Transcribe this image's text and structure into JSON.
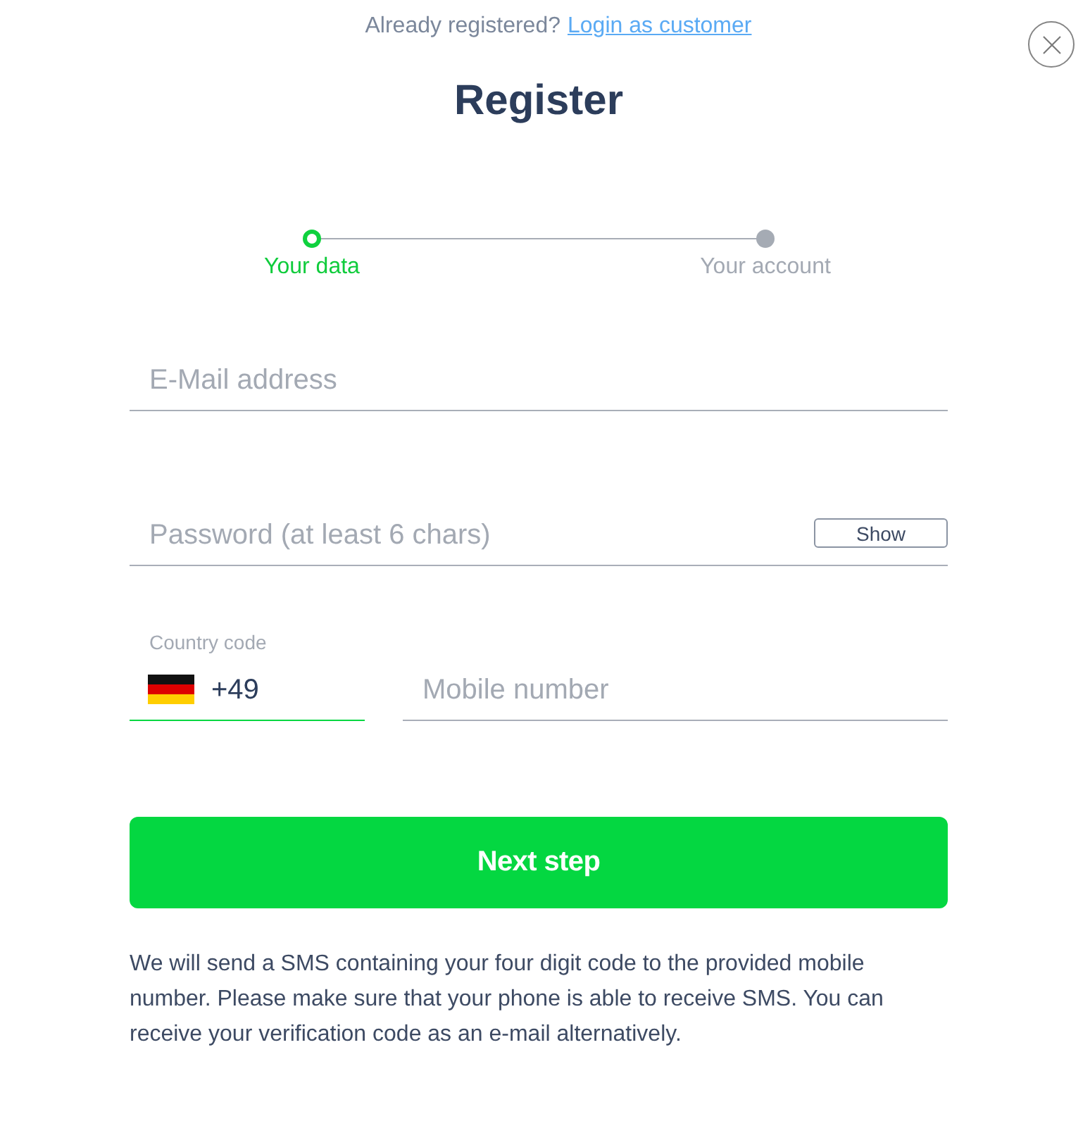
{
  "header": {
    "prompt": "Already registered?",
    "link": "Login as customer"
  },
  "title": "Register",
  "stepper": {
    "steps": [
      {
        "label": "Your data",
        "selected": true
      },
      {
        "label": "Your account",
        "selected": false
      }
    ]
  },
  "form": {
    "email": {
      "placeholder": "E-Mail address",
      "focused": false
    },
    "password": {
      "placeholder": "Password (at least 6 chars)",
      "toggle": "Show",
      "focused": false
    },
    "country_code": {
      "label": "Country code",
      "value": "+49",
      "focused": true
    },
    "mobile": {
      "placeholder": "Mobile number",
      "focused": false
    }
  },
  "submit": "Next step",
  "note": "We will send a SMS containing your four digit code to the provided mobile number. Please make sure that your phone is able to receive SMS. You can receive your verification code as an e-mail alternatively."
}
